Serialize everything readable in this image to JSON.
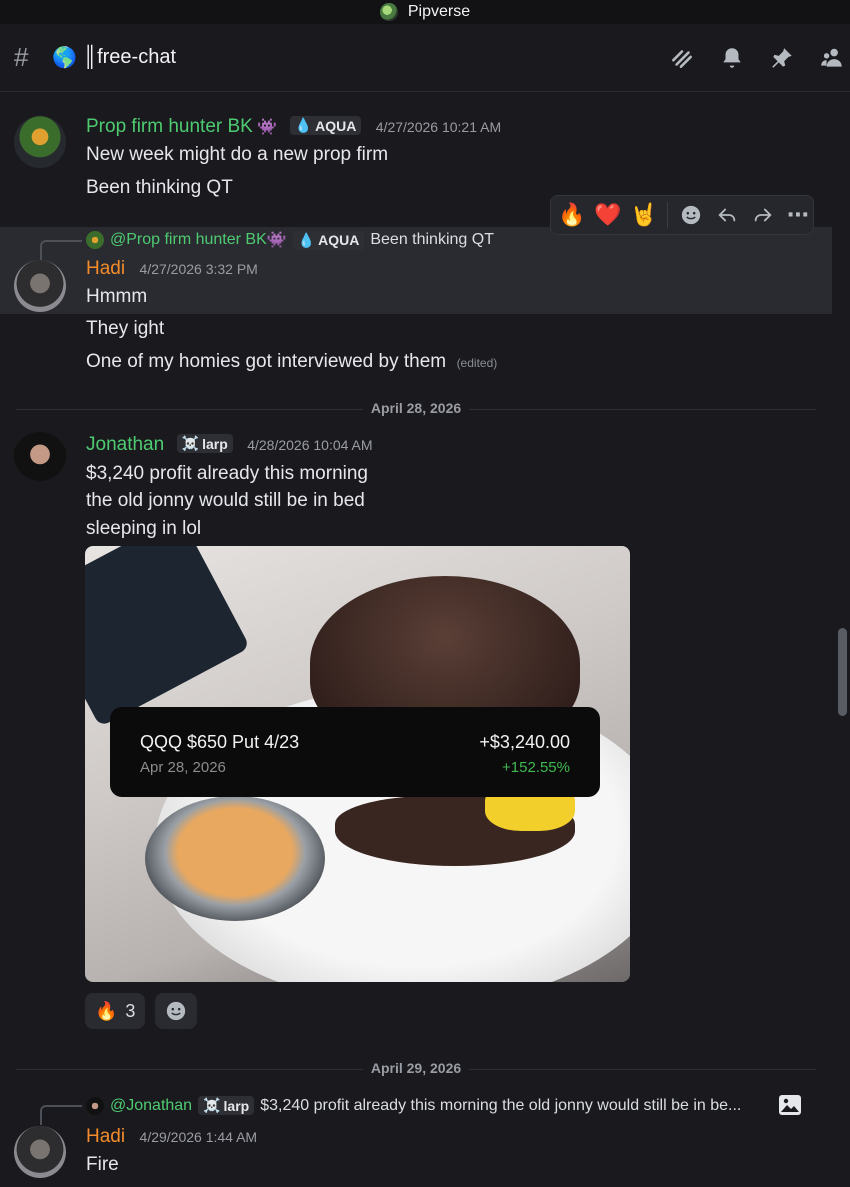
{
  "app": {
    "title": "Pipverse"
  },
  "channel": {
    "name": "free-chat",
    "prefix_icon": "globe-emoji"
  },
  "header_icons": [
    "threads-icon",
    "bell-icon",
    "pin-icon",
    "members-icon"
  ],
  "messages": [
    {
      "author": "Prop firm hunter BK",
      "author_emoji": "👾",
      "tag": "AQUA",
      "tag_emoji": "💧",
      "timestamp": "4/27/2026 10:21 AM",
      "lines": [
        "New week might do a new prop firm",
        "Been thinking QT"
      ]
    },
    {
      "reply_to": {
        "author": "@Prop firm hunter BK",
        "author_emoji": "👾",
        "tag": "AQUA",
        "tag_emoji": "💧",
        "text": "Been thinking QT"
      },
      "author": "Hadi",
      "timestamp": "4/27/2026 3:32 PM",
      "lines": [
        "Hmmm",
        "They ight",
        "One of my homies got interviewed by them"
      ],
      "edited_label": "(edited)"
    },
    {
      "author": "Jonathan",
      "tag": "larp",
      "tag_emoji": "☠️",
      "timestamp": "4/28/2026 10:04 AM",
      "lines": [
        "$3,240 profit already this morning",
        "the old jonny would still be in bed",
        "sleeping in lol"
      ],
      "attachment": {
        "trade": {
          "symbol": "QQQ $650 Put 4/23",
          "date": "Apr 28, 2026",
          "amount": "+$3,240.00",
          "percent": "+152.55%"
        }
      },
      "reactions": [
        {
          "emoji": "🔥",
          "count": "3"
        }
      ]
    },
    {
      "reply_to": {
        "author": "@Jonathan",
        "tag": "larp",
        "tag_emoji": "☠️",
        "text": "$3,240 profit already this morning the old jonny would still be in be..."
      },
      "author": "Hadi",
      "timestamp": "4/29/2026 1:44 AM",
      "lines": [
        "Fire"
      ]
    }
  ],
  "dividers": [
    "April 28, 2026",
    "April 29, 2026"
  ],
  "action_bar": {
    "quick_reactions": [
      "🔥",
      "❤️",
      "🤘"
    ]
  },
  "colors": {
    "background": "#1a1a1e",
    "green_name": "#4ecb71",
    "orange_name": "#f48c2c",
    "profit_green": "#3fb950"
  }
}
